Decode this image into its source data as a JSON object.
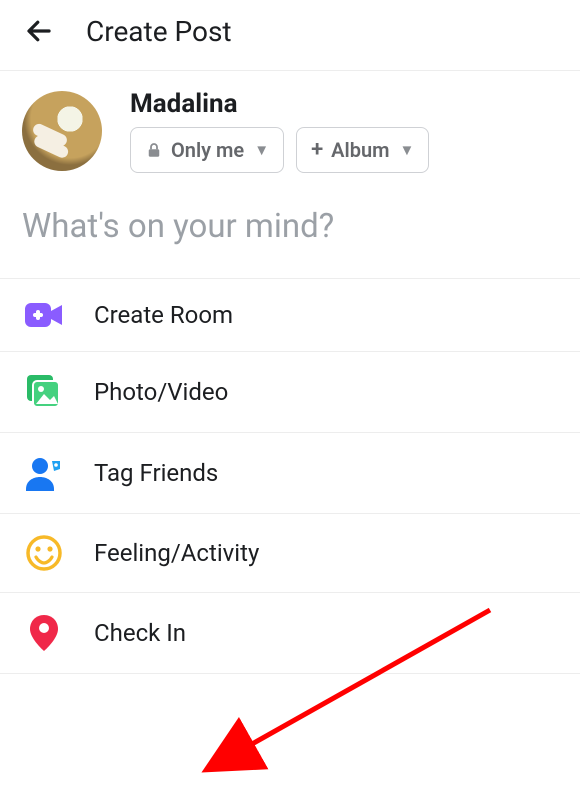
{
  "header": {
    "title": "Create Post"
  },
  "user": {
    "name": "Madalina",
    "privacy_label": "Only me",
    "album_label": "Album"
  },
  "composer": {
    "placeholder": "What's on your mind?"
  },
  "options": {
    "create_room": "Create Room",
    "photo_video": "Photo/Video",
    "tag_friends": "Tag Friends",
    "feeling_activity": "Feeling/Activity",
    "check_in": "Check In"
  },
  "icons": {
    "back": "back-arrow-icon",
    "lock": "lock-icon",
    "plus": "plus-icon",
    "room": "video-plus-icon",
    "photo": "photo-video-icon",
    "tag": "tag-friends-icon",
    "feeling": "smiley-icon",
    "checkin": "location-pin-icon"
  }
}
